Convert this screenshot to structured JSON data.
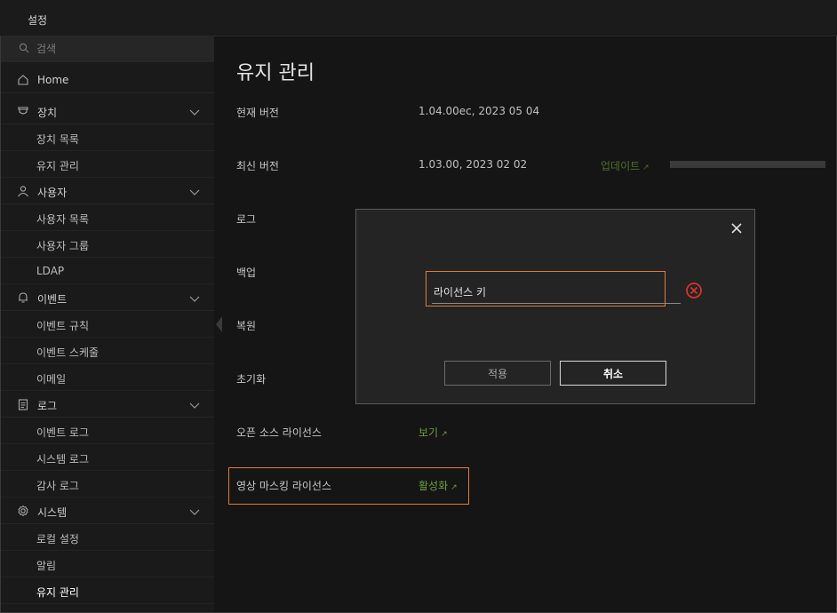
{
  "window": {
    "title": "설정"
  },
  "search": {
    "placeholder": "검색"
  },
  "sidebar": {
    "home": "Home",
    "groups": [
      {
        "label": "장치",
        "items": [
          "장치 목록",
          "유지 관리"
        ]
      },
      {
        "label": "사용자",
        "items": [
          "사용자 목록",
          "사용자 그룹",
          "LDAP"
        ]
      },
      {
        "label": "이벤트",
        "items": [
          "이벤트 규칙",
          "이벤트 스케줄",
          "이메일"
        ]
      },
      {
        "label": "로그",
        "items": [
          "이벤트 로그",
          "시스템 로그",
          "감사 로그"
        ]
      },
      {
        "label": "시스템",
        "items": [
          "로컬 설정",
          "알림",
          "유지 관리"
        ]
      }
    ]
  },
  "main": {
    "title": "유지 관리",
    "rows": {
      "current_version": {
        "label": "현재 버전",
        "value": "1.04.00ec, 2023 05 04"
      },
      "latest_version": {
        "label": "최신 버전",
        "value": "1.03.00, 2023 02 02",
        "link": "업데이트",
        "progress": 0
      },
      "log": {
        "label": "로그"
      },
      "backup": {
        "label": "백업"
      },
      "restore": {
        "label": "복원"
      },
      "reset": {
        "label": "초기화"
      },
      "oss_license": {
        "label": "오픈 소스 라이선스",
        "link": "보기"
      },
      "video_masking": {
        "label": "영상 마스킹 라이선스",
        "link": "활성화"
      }
    }
  },
  "dialog": {
    "license_key_value": "라이선스 키",
    "apply_label": "적용",
    "cancel_label": "취소"
  },
  "colors": {
    "link": "#6f9f3a",
    "highlight": "#e07b39",
    "error": "#d9332b"
  }
}
